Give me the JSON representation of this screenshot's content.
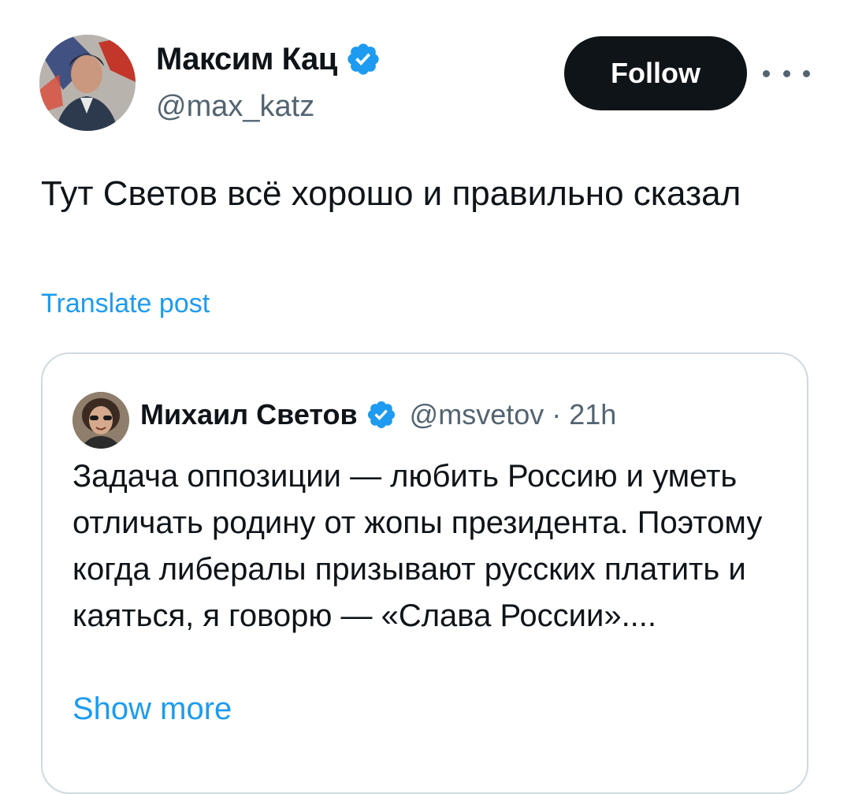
{
  "author": {
    "name": "Максим Кац",
    "handle": "@max_katz",
    "verified_icon": "verified-badge-icon",
    "avatar_icon": "avatar-photo"
  },
  "actions": {
    "follow_label": "Follow",
    "more_icon": "more-options-icon"
  },
  "post": {
    "text": "Тут Светов всё хорошо и правильно сказал",
    "translate_label": "Translate post"
  },
  "quoted_post": {
    "author_name": "Михаил Светов",
    "handle": "@msvetov",
    "separator": "·",
    "time": "21h",
    "text": "Задача оппозиции — любить Россию и уметь отличать родину от жопы президента. Поэтому когда либералы призывают русских платить и каяться, я говорю — «Слава России»....",
    "show_more_label": "Show more"
  },
  "colors": {
    "text": "#0f1419",
    "secondary": "#536471",
    "link": "#1d9bf0",
    "button_bg": "#0f1419",
    "border": "#cfd9de"
  }
}
